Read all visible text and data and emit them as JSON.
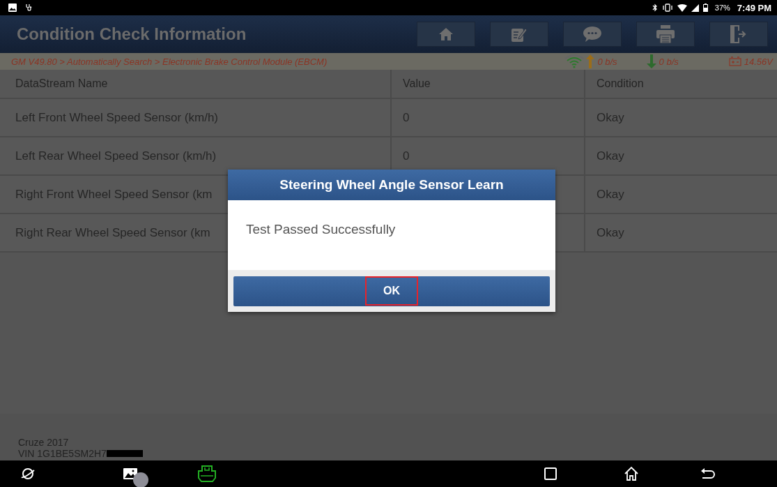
{
  "status_bar": {
    "battery": "37%",
    "time": "7:49 PM"
  },
  "header": {
    "title": "Condition Check Information"
  },
  "breadcrumb": "GM V49.80 > Automatically Search > Electronic Brake Control Module (EBCM)",
  "connection": {
    "upload": "0 b/s",
    "download": "0 b/s",
    "voltage": "14.56V"
  },
  "table": {
    "columns": [
      "DataStream Name",
      "Value",
      "Condition"
    ],
    "rows": [
      {
        "name": "Left Front Wheel Speed Sensor (km/h)",
        "value": "0",
        "condition": "Okay"
      },
      {
        "name": "Left Rear Wheel Speed Sensor (km/h)",
        "value": "0",
        "condition": "Okay"
      },
      {
        "name": "Right Front Wheel Speed Sensor (km",
        "condition": "Okay"
      },
      {
        "name": "Right Rear Wheel Speed Sensor (km",
        "condition": "Okay"
      }
    ]
  },
  "vehicle": {
    "model": "Cruze 2017",
    "vin": "VIN 1G1BE5SM2H7"
  },
  "dialog": {
    "title": "Steering Wheel Angle Sensor Learn",
    "message": "Test Passed Successfully",
    "button": {
      "label": "OK",
      "highlighted": true
    }
  }
}
